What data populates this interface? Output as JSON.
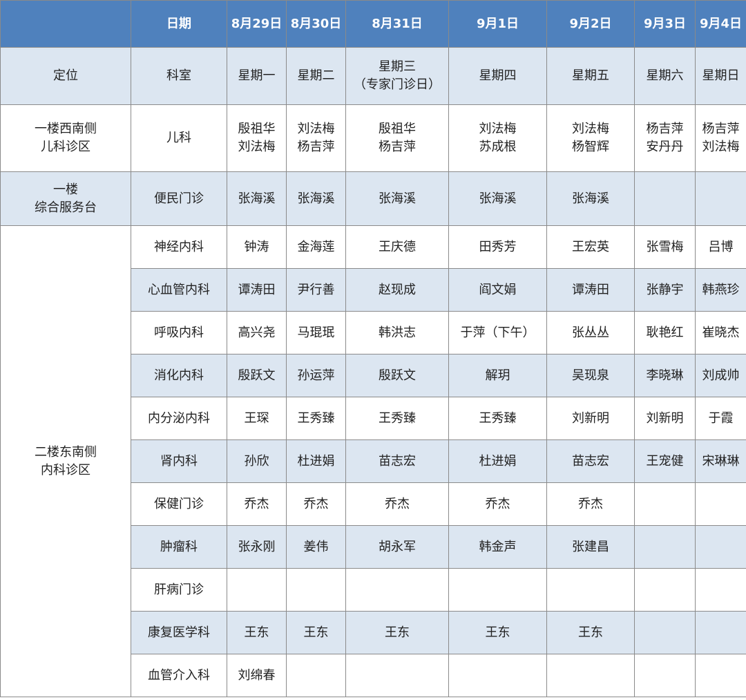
{
  "header": {
    "corner": "",
    "date_label": "日期",
    "dates": [
      "8月29日",
      "8月30日",
      "8月31日",
      "9月1日",
      "9月2日",
      "9月3日",
      "9月4日"
    ]
  },
  "subheader": {
    "location_label": "定位",
    "dept_label": "科室",
    "weekdays": [
      "星期一",
      "星期二",
      "星期三\n（专家门诊日）",
      "星期四",
      "星期五",
      "星期六",
      "星期日"
    ]
  },
  "pediatrics": {
    "location": "一楼西南侧\n儿科诊区",
    "dept": "儿科",
    "doctors": [
      "殷祖华\n刘法梅",
      "刘法梅\n杨吉萍",
      "殷祖华\n杨吉萍",
      "刘法梅\n苏成根",
      "刘法梅\n杨智辉",
      "杨吉萍\n安丹丹",
      "杨吉萍\n刘法梅"
    ]
  },
  "general": {
    "location": "一楼\n综合服务台",
    "dept": "便民门诊",
    "doctors": [
      "张海溪",
      "张海溪",
      "张海溪",
      "张海溪",
      "张海溪",
      "",
      ""
    ]
  },
  "internal": {
    "location": "二楼东南侧\n内科诊区",
    "rows": [
      {
        "dept": "神经内科",
        "doctors": [
          "钟涛",
          "金海莲",
          "王庆德",
          "田秀芳",
          "王宏英",
          "张雪梅",
          "吕博"
        ]
      },
      {
        "dept": "心血管内科",
        "doctors": [
          "谭涛田",
          "尹行善",
          "赵现成",
          "阎文娟",
          "谭涛田",
          "张静宇",
          "韩燕珍"
        ]
      },
      {
        "dept": "呼吸内科",
        "doctors": [
          "高兴尧",
          "马琨珉",
          "韩洪志",
          "于萍（下午）",
          "张丛丛",
          "耿艳红",
          "崔晓杰"
        ]
      },
      {
        "dept": "消化内科",
        "doctors": [
          "殷跃文",
          "孙运萍",
          "殷跃文",
          "解玥",
          "吴现泉",
          "李晓琳",
          "刘成帅"
        ]
      },
      {
        "dept": "内分泌内科",
        "doctors": [
          "王琛",
          "王秀臻",
          "王秀臻",
          "王秀臻",
          "刘新明",
          "刘新明",
          "于霞"
        ]
      },
      {
        "dept": "肾内科",
        "doctors": [
          "孙欣",
          "杜进娟",
          "苗志宏",
          "杜进娟",
          "苗志宏",
          "王宠健",
          "宋琳琳"
        ]
      },
      {
        "dept": "保健门诊",
        "doctors": [
          "乔杰",
          "乔杰",
          "乔杰",
          "乔杰",
          "乔杰",
          "",
          ""
        ]
      },
      {
        "dept": "肿瘤科",
        "doctors": [
          "张永刚",
          "姜伟",
          "胡永军",
          "韩金声",
          "张建昌",
          "",
          ""
        ]
      },
      {
        "dept": "肝病门诊",
        "doctors": [
          "",
          "",
          "",
          "",
          "",
          "",
          ""
        ]
      },
      {
        "dept": "康复医学科",
        "doctors": [
          "王东",
          "王东",
          "王东",
          "王东",
          "王东",
          "",
          ""
        ]
      },
      {
        "dept": "血管介入科",
        "doctors": [
          "刘绵春",
          "",
          "",
          "",
          "",
          "",
          ""
        ]
      }
    ]
  },
  "colors": {
    "header_bg": "#4f81bd",
    "header_text": "#ffffff",
    "shade_bg": "#dce6f1",
    "border": "#8a8a8a"
  }
}
